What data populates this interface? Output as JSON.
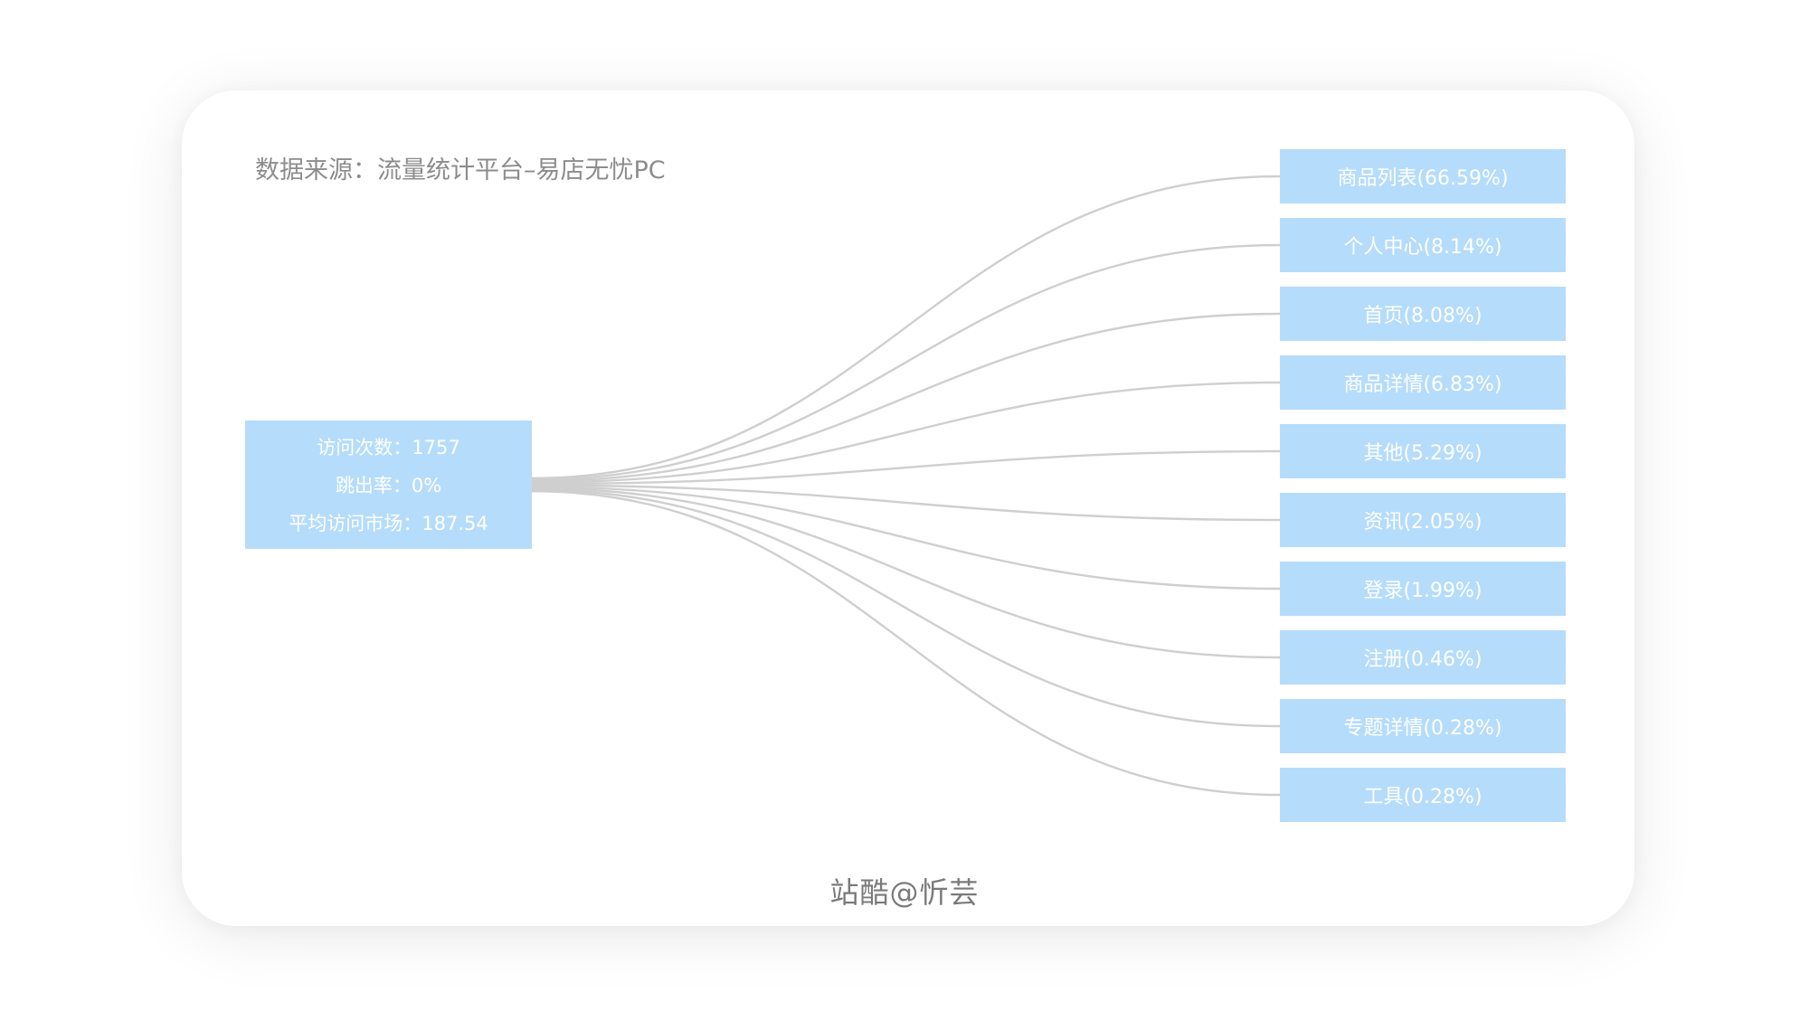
{
  "source_label": "数据来源：流量统计平台–易店无忧PC",
  "source_node": {
    "visits": "访问次数：1757",
    "bounce_rate": "跳出率：0%",
    "avg_duration": "平均访问市场：187.54"
  },
  "targets": [
    {
      "label": "商品列表(66.59%)",
      "percent": 66.59
    },
    {
      "label": "个人中心(8.14%)",
      "percent": 8.14
    },
    {
      "label": "首页(8.08%)",
      "percent": 8.08
    },
    {
      "label": "商品详情(6.83%)",
      "percent": 6.83
    },
    {
      "label": "其他(5.29%)",
      "percent": 5.29
    },
    {
      "label": "资讯(2.05%)",
      "percent": 2.05
    },
    {
      "label": "登录(1.99%)",
      "percent": 1.99
    },
    {
      "label": "注册(0.46%)",
      "percent": 0.46
    },
    {
      "label": "专题详情(0.28%)",
      "percent": 0.28
    },
    {
      "label": "工具(0.28%)",
      "percent": 0.28
    }
  ],
  "watermark": "站酷@忻芸",
  "colors": {
    "node_fill": "#b5dcfb",
    "link_stroke": "#cfcfcf",
    "label_text": "#8c8c8c"
  }
}
